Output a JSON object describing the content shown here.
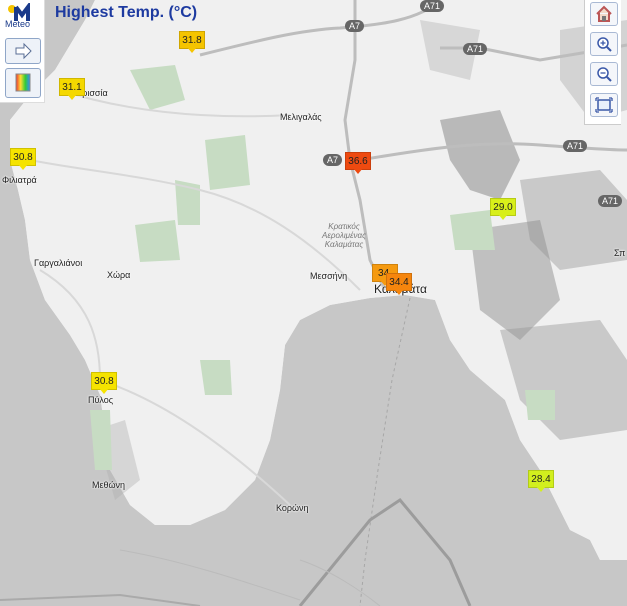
{
  "title": "Highest Temp. (°C)",
  "logo": {
    "text": "Meteo",
    "icon": "meteo-logo-icon",
    "color": "#1a3a8a"
  },
  "sidebar": {
    "buttons": [
      {
        "name": "arrow-right-icon"
      },
      {
        "name": "color-palette-icon"
      }
    ]
  },
  "zoom_controls": {
    "buttons": [
      {
        "name": "home-icon"
      },
      {
        "name": "zoom-in-icon"
      },
      {
        "name": "zoom-out-icon"
      },
      {
        "name": "fullscreen-icon"
      }
    ]
  },
  "places": {
    "meligalas": "Μελιγαλάς",
    "filiatra": "Φιλιατρά",
    "gargalianoi": "Γαργαλιάνοι",
    "chora": "Χώρα",
    "messini": "Μεσσήνη",
    "kalamata": "Καλαμάτα",
    "pylos": "Πύλος",
    "methoni": "Μεθώνη",
    "koroni": "Κορώνη",
    "kyparissia": "Κυπαρισσία",
    "sp": "Σπ"
  },
  "park_label": "Κρατικός Αερολιμένας Καλαμάτας",
  "roads": {
    "a7_top": "A7",
    "a71_top": "A71",
    "a71_mid": "A71",
    "a71_right": "A71",
    "a7_mid": "A7",
    "a71_far": "A71"
  },
  "markers": [
    {
      "value": "31.8",
      "color": "#f5c400"
    },
    {
      "value": "31.1",
      "color": "#f5d800"
    },
    {
      "value": "30.8",
      "color": "#f5e300"
    },
    {
      "value": "36.6",
      "color": "#ee4a10"
    },
    {
      "value": "29.0",
      "color": "#d8ef1a"
    },
    {
      "value": "34.",
      "color": "#f59a10"
    },
    {
      "value": "34.4",
      "color": "#f5850d"
    },
    {
      "value": "30.8",
      "color": "#f5e300"
    },
    {
      "value": "28.4",
      "color": "#d2ef1e"
    }
  ],
  "colors": {
    "sea": "#c7c7c7",
    "land": "#f0f0f0",
    "park": "#c7dcc3",
    "title": "#1d3aa0"
  }
}
